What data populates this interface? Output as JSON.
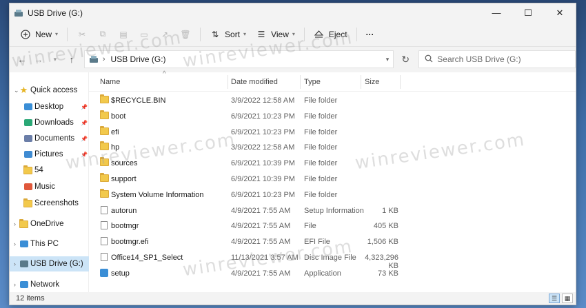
{
  "window": {
    "title": "USB Drive (G:)",
    "controls": [
      "—",
      "☐",
      "✕"
    ]
  },
  "toolbar": {
    "new_label": "New",
    "sort_label": "Sort",
    "view_label": "View",
    "eject_label": "Eject",
    "more_label": "···"
  },
  "address": {
    "path": "USB Drive (G:)",
    "search_placeholder": "Search USB Drive (G:)"
  },
  "nav": {
    "items": [
      {
        "label": "Quick access",
        "icon": "star-icon",
        "color": "#e6b422"
      },
      {
        "label": "Desktop",
        "icon": "desktop-icon",
        "color": "#3a8ed6",
        "pinned": true
      },
      {
        "label": "Downloads",
        "icon": "download-icon",
        "color": "#2aa876",
        "pinned": true
      },
      {
        "label": "Documents",
        "icon": "document-icon",
        "color": "#6b7ea8",
        "pinned": true
      },
      {
        "label": "Pictures",
        "icon": "pictures-icon",
        "color": "#3f8bd2",
        "pinned": true
      },
      {
        "label": "54",
        "icon": "folder-icon",
        "color": "#f2c94c"
      },
      {
        "label": "Music",
        "icon": "music-icon",
        "color": "#e0583b"
      },
      {
        "label": "Screenshots",
        "icon": "folder-icon",
        "color": "#f2c94c"
      },
      {
        "label": "OneDrive",
        "icon": "folder-icon",
        "color": "#f2c94c"
      },
      {
        "label": "This PC",
        "icon": "pc-icon",
        "color": "#3a8ed6"
      },
      {
        "label": "USB Drive (G:)",
        "icon": "usb-drive-icon",
        "color": "#5a7a8a"
      },
      {
        "label": "Network",
        "icon": "network-icon",
        "color": "#3a8ed6"
      }
    ]
  },
  "columns": {
    "name": "Name",
    "date": "Date modified",
    "type": "Type",
    "size": "Size"
  },
  "files": [
    {
      "name": "$RECYCLE.BIN",
      "date": "3/9/2022 12:58 AM",
      "type": "File folder",
      "size": "",
      "icon": "folder-icon"
    },
    {
      "name": "boot",
      "date": "6/9/2021 10:23 PM",
      "type": "File folder",
      "size": "",
      "icon": "folder-icon"
    },
    {
      "name": "efi",
      "date": "6/9/2021 10:23 PM",
      "type": "File folder",
      "size": "",
      "icon": "folder-icon"
    },
    {
      "name": "hp",
      "date": "3/9/2022 12:58 AM",
      "type": "File folder",
      "size": "",
      "icon": "folder-icon"
    },
    {
      "name": "sources",
      "date": "6/9/2021 10:39 PM",
      "type": "File folder",
      "size": "",
      "icon": "folder-icon"
    },
    {
      "name": "support",
      "date": "6/9/2021 10:39 PM",
      "type": "File folder",
      "size": "",
      "icon": "folder-icon"
    },
    {
      "name": "System Volume Information",
      "date": "6/9/2021 10:23 PM",
      "type": "File folder",
      "size": "",
      "icon": "folder-icon"
    },
    {
      "name": "autorun",
      "date": "4/9/2021 7:55 AM",
      "type": "Setup Information",
      "size": "1 KB",
      "icon": "settings-file-icon"
    },
    {
      "name": "bootmgr",
      "date": "4/9/2021 7:55 AM",
      "type": "File",
      "size": "405 KB",
      "icon": "file-icon"
    },
    {
      "name": "bootmgr.efi",
      "date": "4/9/2021 7:55 AM",
      "type": "EFI File",
      "size": "1,506 KB",
      "icon": "file-icon"
    },
    {
      "name": "Office14_SP1_Select",
      "date": "11/13/2021 3:57 AM",
      "type": "Disc Image File",
      "size": "4,323,296 KB",
      "icon": "disc-image-icon"
    },
    {
      "name": "setup",
      "date": "4/9/2021 7:55 AM",
      "type": "Application",
      "size": "73 KB",
      "icon": "app-icon"
    }
  ],
  "status": {
    "count": "12 items"
  },
  "watermark": "winreviewer.com"
}
